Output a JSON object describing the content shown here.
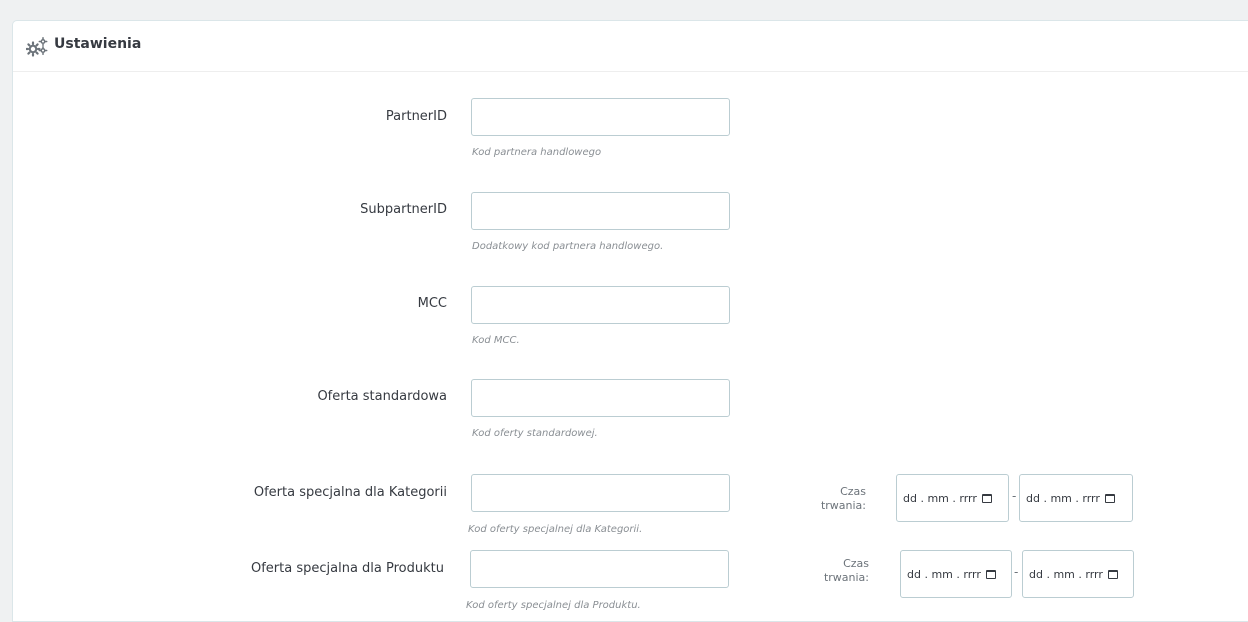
{
  "panel": {
    "title": "Ustawienia",
    "icon": "cogs-icon"
  },
  "fields": {
    "partner_id": {
      "label": "PartnerID",
      "value": "",
      "help": "Kod partnera handlowego"
    },
    "subpartner_id": {
      "label": "SubpartnerID",
      "value": "",
      "help": "Dodatkowy kod partnera handlowego."
    },
    "mcc": {
      "label": "MCC",
      "value": "",
      "help": "Kod MCC."
    },
    "standard_offer": {
      "label": "Oferta standardowa",
      "value": "",
      "help": "Kod oferty standardowej."
    },
    "category_offer": {
      "label": "Oferta specjalna dla Kategorii",
      "value": "",
      "help": "Kod oferty specjalnej dla Kategorii.",
      "duration_label_line1": "Czas",
      "duration_label_line2": "trwania:",
      "date_from": "dd . mm . rrrr",
      "date_to": "dd . mm . rrrr",
      "separator": "-"
    },
    "product_offer": {
      "label": "Oferta specjalna dla Produktu",
      "value": "",
      "help": "Kod oferty specjalnej dla Produktu.",
      "duration_label_line1": "Czas",
      "duration_label_line2": "trwania:",
      "date_from": "dd . mm . rrrr",
      "date_to": "dd . mm . rrrr",
      "separator": "-"
    }
  },
  "colors": {
    "page_bg": "#eff1f2",
    "panel_bg": "#ffffff",
    "input_border": "#bbcdd2",
    "help_text": "#8a8f94"
  }
}
